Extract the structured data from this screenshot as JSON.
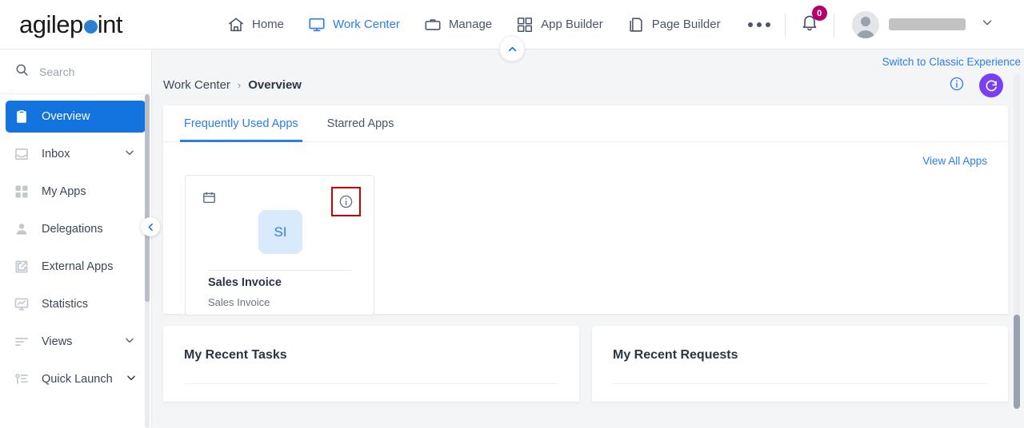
{
  "brand": {
    "name_part1": "agilep",
    "name_part2": "int",
    "dot_color": "#2f7fd1"
  },
  "header": {
    "nav": [
      {
        "label": "Home",
        "icon": "home-icon",
        "active": false
      },
      {
        "label": "Work Center",
        "icon": "monitor-icon",
        "active": true
      },
      {
        "label": "Manage",
        "icon": "briefcase-icon",
        "active": false
      },
      {
        "label": "App Builder",
        "icon": "grid-icon",
        "active": false
      },
      {
        "label": "Page Builder",
        "icon": "pages-icon",
        "active": false
      }
    ],
    "more_label": "more-options",
    "notification_count": "0",
    "user_name": "",
    "accent_color": "#2b7de9",
    "badge_color": "#b5006b"
  },
  "sidebar": {
    "search_placeholder": "Search",
    "search_value": "",
    "items": [
      {
        "label": "Overview",
        "icon": "clipboard-icon",
        "active": true,
        "chevron": false
      },
      {
        "label": "Inbox",
        "icon": "inbox-icon",
        "active": false,
        "chevron": true
      },
      {
        "label": "My Apps",
        "icon": "grid-icon",
        "active": false,
        "chevron": false
      },
      {
        "label": "Delegations",
        "icon": "person-icon",
        "active": false,
        "chevron": false
      },
      {
        "label": "External Apps",
        "icon": "external-link-icon",
        "active": false,
        "chevron": false
      },
      {
        "label": "Statistics",
        "icon": "chart-monitor-icon",
        "active": false,
        "chevron": false
      },
      {
        "label": "Views",
        "icon": "filter-lines-icon",
        "active": false,
        "chevron": true
      },
      {
        "label": "Quick Launch",
        "icon": "quick-launch-icon",
        "active": false,
        "chevron": true
      }
    ],
    "active_color": "#1374e0"
  },
  "main": {
    "classic_link": "Switch to Classic Experience",
    "breadcrumb": {
      "root": "Work Center",
      "separator": "›",
      "current": "Overview"
    },
    "actions": {
      "info_label": "info",
      "refresh_label": "refresh",
      "refresh_color": "#7b3ff2"
    },
    "tabs": [
      {
        "label": "Frequently Used Apps",
        "active": true
      },
      {
        "label": "Starred Apps",
        "active": false
      }
    ],
    "view_all_label": "View All Apps",
    "app_tiles": [
      {
        "initials": "SI",
        "title": "Sales Invoice",
        "subtitle": "Sales Invoice",
        "type_icon": "calendar-icon",
        "info_icon": "info-icon",
        "info_highlight_color": "#cc0000",
        "badge_bg": "#d9eafc",
        "badge_text_color": "#2b7de9"
      }
    ],
    "lower_cards": [
      {
        "title": "My Recent Tasks"
      },
      {
        "title": "My Recent Requests"
      }
    ]
  }
}
